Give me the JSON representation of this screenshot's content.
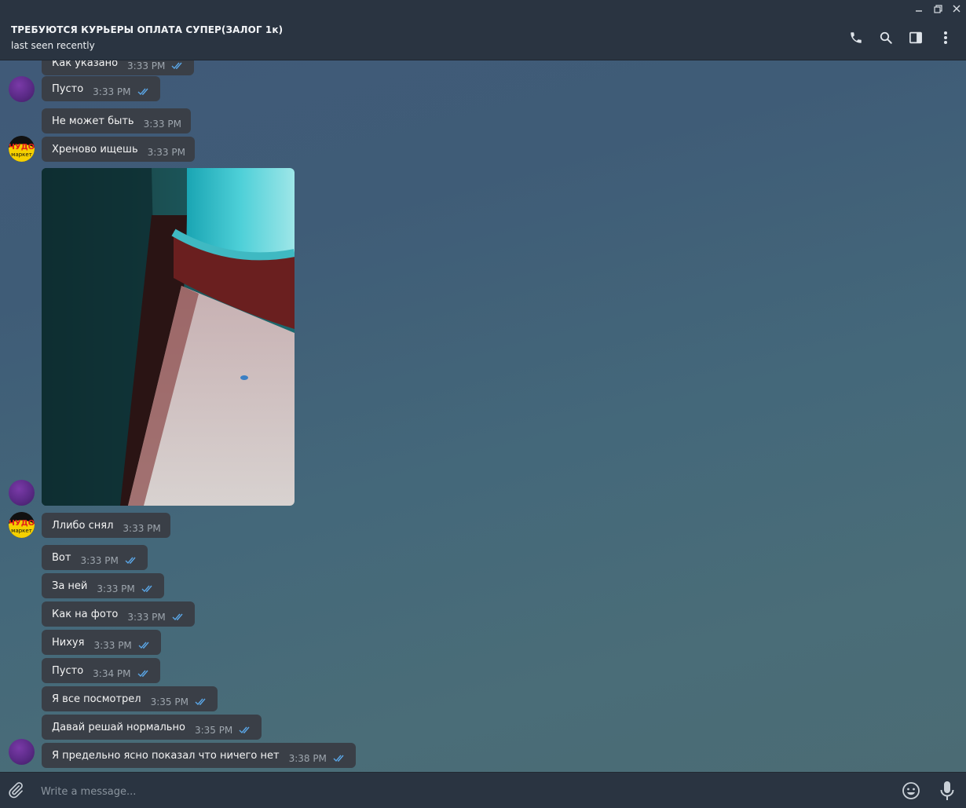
{
  "window": {
    "minimize": "—",
    "restore": "❐",
    "close": "✕"
  },
  "header": {
    "title": "ТРЕБУЮТСЯ КУРЬЕРЫ ОПЛАТА СУПЕР(ЗАЛОГ 1к)",
    "status": "last seen recently",
    "icons": [
      "phone-icon",
      "search-icon",
      "sidebar-icon",
      "more-icon"
    ]
  },
  "colors": {
    "header": "#2a3441",
    "bubble": "#3a3f47",
    "check": "#5aa6e6",
    "time": "#9ea6ae"
  },
  "messages": [
    {
      "text": "Как указано",
      "time": "3:33 PM",
      "read": true
    },
    {
      "text": "Пусто",
      "time": "3:33 PM",
      "read": true
    },
    {
      "text": "Не может быть",
      "time": "3:33 PM",
      "read": false
    },
    {
      "text": "Хреново ищешь",
      "time": "3:33 PM",
      "read": false
    },
    {
      "text": "Ллибо снял",
      "time": "3:33 PM",
      "read": false
    },
    {
      "text": "Вот",
      "time": "3:33 PM",
      "read": true
    },
    {
      "text": "За ней",
      "time": "3:33 PM",
      "read": true
    },
    {
      "text": "Как на фото",
      "time": "3:33 PM",
      "read": true
    },
    {
      "text": "Нихуя",
      "time": "3:33 PM",
      "read": true
    },
    {
      "text": "Пусто",
      "time": "3:34 PM",
      "read": true
    },
    {
      "text": "Я все посмотрел",
      "time": "3:35 PM",
      "read": true
    },
    {
      "text": "Давай решай нормально",
      "time": "3:35 PM",
      "read": true
    },
    {
      "text": "Я предельно ясно показал что ничего нет",
      "time": "3:38 PM",
      "read": true
    }
  ],
  "avatar_logo_text": [
    "ЧУДО",
    "маркет"
  ],
  "composer": {
    "placeholder": "Write a message...",
    "icons": [
      "attach-icon",
      "emoji-icon",
      "mic-icon"
    ]
  }
}
